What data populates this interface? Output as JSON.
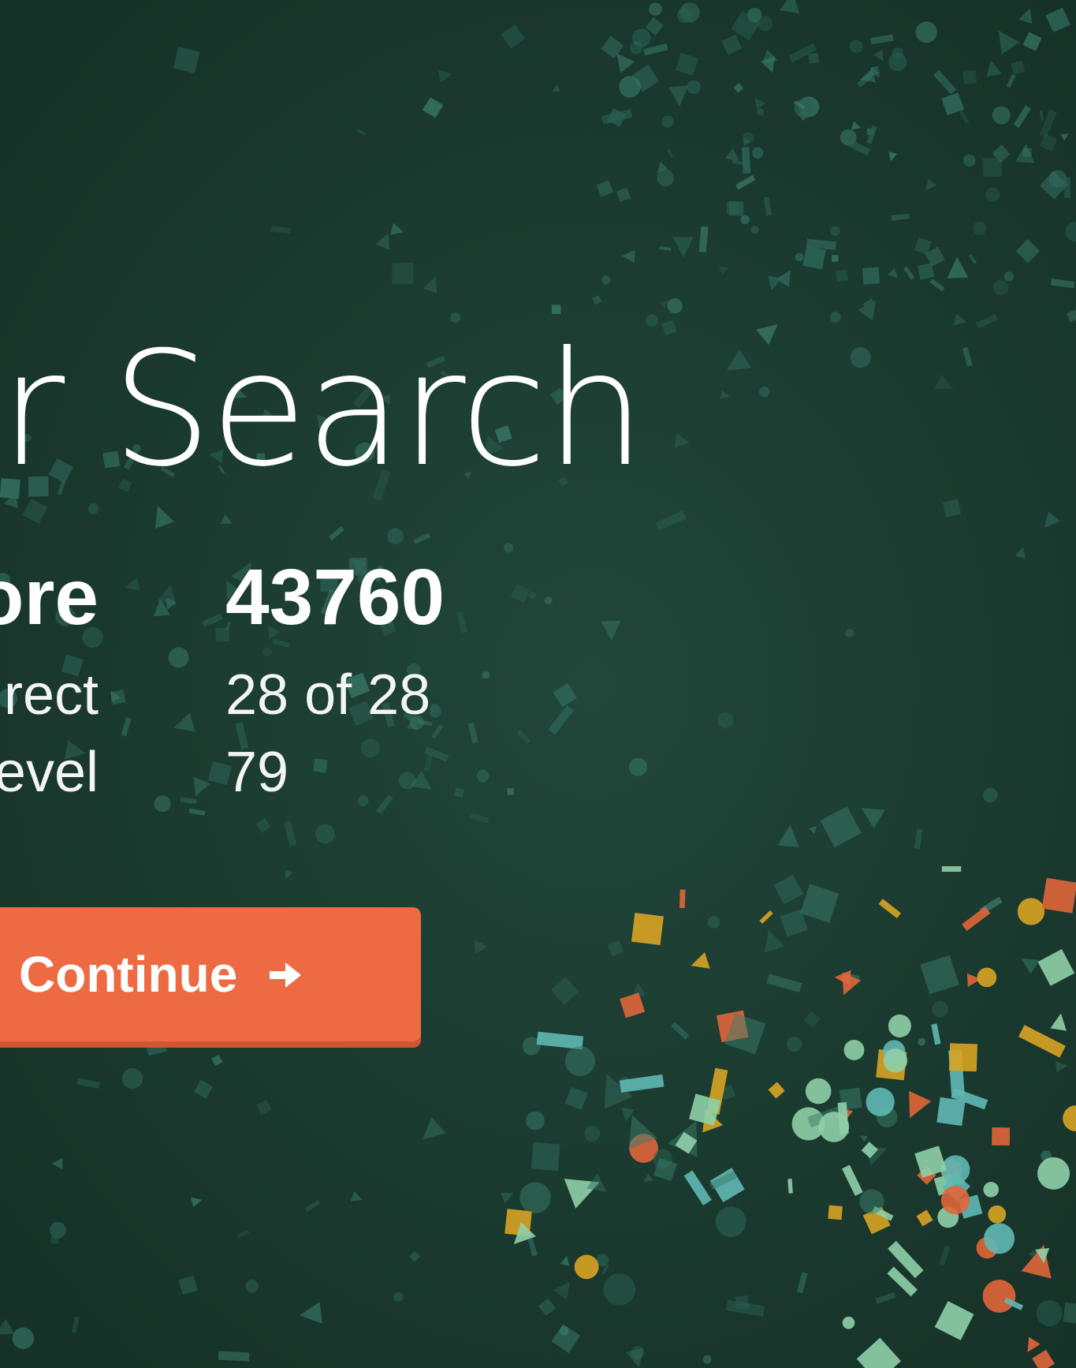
{
  "screen": {
    "title": "r Search"
  },
  "results": {
    "score_label": "ore",
    "score_value": "43760",
    "correct_label": "rect",
    "correct_value": "28 of 28",
    "level_label": "evel",
    "level_value": "79"
  },
  "actions": {
    "continue_label": "Continue",
    "continue_icon": "arrow-right-icon"
  },
  "colors": {
    "background": "#1c3c31",
    "accent_button": "#ee6a43",
    "confetti_dark": [
      "#2f6b5d",
      "#3a7d6c",
      "#2a5f52"
    ],
    "confetti_bright": [
      "#e0663a",
      "#d9a423",
      "#5fb8b4",
      "#8fcfa8"
    ]
  }
}
